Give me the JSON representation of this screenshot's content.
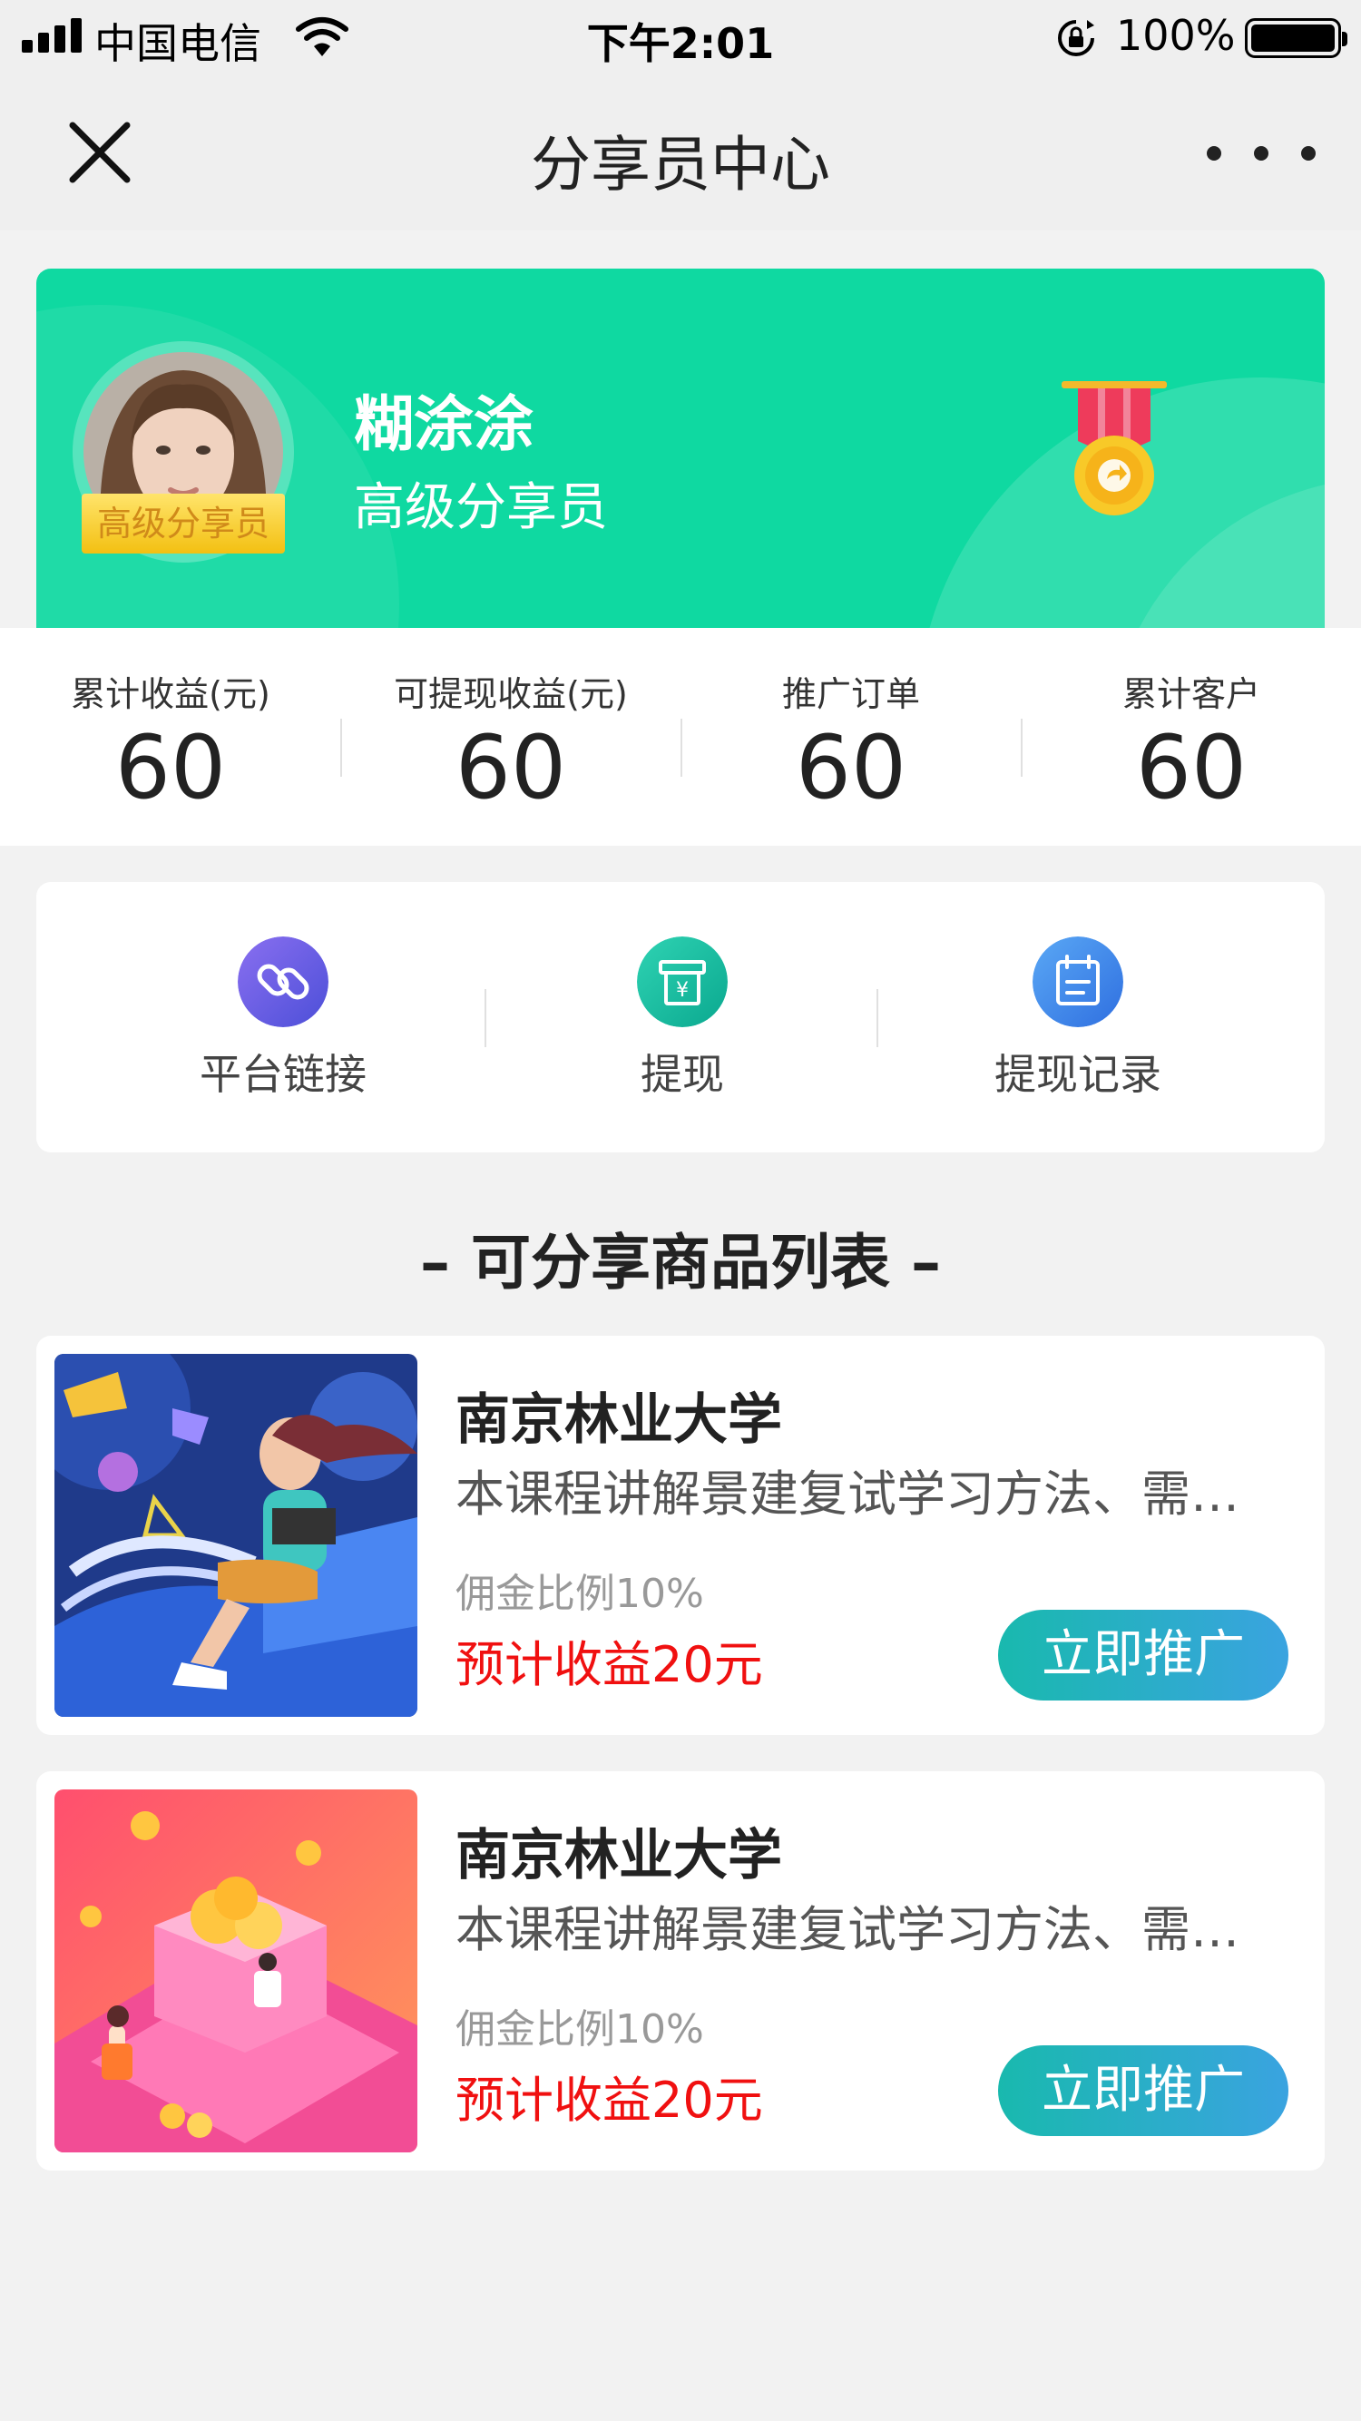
{
  "status_bar": {
    "carrier": "中国电信",
    "time": "下午2:01",
    "battery": "100%"
  },
  "nav": {
    "title": "分享员中心"
  },
  "profile": {
    "badge": "高级分享员",
    "name": "糊涂涂",
    "level": "高级分享员"
  },
  "stats": [
    {
      "label": "累计收益(元)",
      "value": "60"
    },
    {
      "label": "可提现收益(元)",
      "value": "60"
    },
    {
      "label": "推广订单",
      "value": "60"
    },
    {
      "label": "累计客户",
      "value": "60"
    }
  ],
  "actions": [
    {
      "label": "平台链接",
      "icon": "link-icon",
      "color": "#6a5ce8"
    },
    {
      "label": "提现",
      "icon": "withdraw-icon",
      "color": "#17c0a2"
    },
    {
      "label": "提现记录",
      "icon": "record-icon",
      "color": "#3f86e8"
    }
  ],
  "section": {
    "title": "– 可分享商品列表 –"
  },
  "products": [
    {
      "title": "南京林业大学",
      "desc": "本课程讲解景建复试学习方法、需…",
      "commission": "佣金比例10%",
      "earnings": "预计收益20元",
      "button": "立即推广"
    },
    {
      "title": "南京林业大学",
      "desc": "本课程讲解景建复试学习方法、需…",
      "commission": "佣金比例10%",
      "earnings": "预计收益20元",
      "button": "立即推广"
    }
  ],
  "colors": {
    "banner": "#0fd9a1",
    "earnings": "#f01010",
    "button_start": "#19b9ae",
    "button_end": "#3aa3e0"
  }
}
